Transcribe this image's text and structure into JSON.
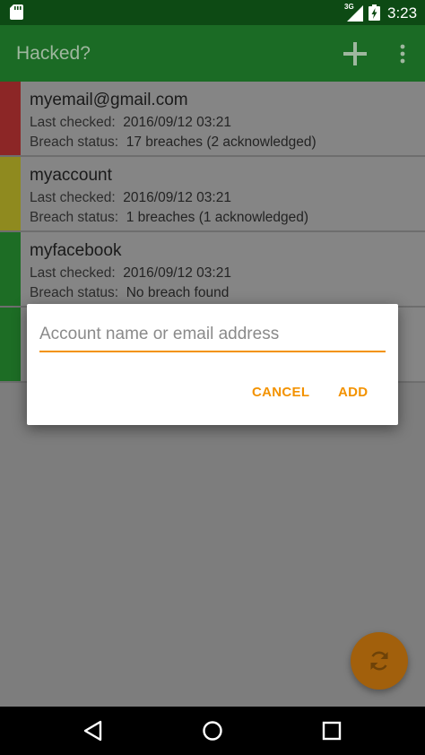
{
  "status_bar": {
    "network_type": "3G",
    "time": "3:23",
    "icons": [
      "sd-card-icon",
      "signal-icon",
      "battery-icon"
    ]
  },
  "app_bar": {
    "title": "Hacked?",
    "add_icon": "plus-icon",
    "menu_icon": "more-vert-icon"
  },
  "accounts": [
    {
      "name": "myemail@gmail.com",
      "last_checked_label": "Last checked:",
      "last_checked": "2016/09/12 03:21",
      "breach_status_label": "Breach status:",
      "breach_status": "17 breaches (2 acknowledged)",
      "indicator_color": "#8c2626"
    },
    {
      "name": "myaccount",
      "last_checked_label": "Last checked:",
      "last_checked": "2016/09/12 03:21",
      "breach_status_label": "Breach status:",
      "breach_status": "1 breaches (1 acknowledged)",
      "indicator_color": "#8f8a1f"
    },
    {
      "name": "myfacebook",
      "last_checked_label": "Last checked:",
      "last_checked": "2016/09/12 03:21",
      "breach_status_label": "Breach status:",
      "breach_status": "No breach found",
      "indicator_color": "#1d6d25"
    },
    {
      "name": "",
      "last_checked_label": "",
      "last_checked": "",
      "breach_status_label": "",
      "breach_status": "",
      "indicator_color": "#1d6d25"
    }
  ],
  "dialog": {
    "input_placeholder": "Account name or email address",
    "input_value": "",
    "cancel_label": "CANCEL",
    "add_label": "ADD",
    "accent_color": "#f39200"
  },
  "fab": {
    "icon": "refresh-icon",
    "color": "#a2600c"
  },
  "nav_bar": {
    "back_icon": "back-icon",
    "home_icon": "home-icon",
    "recents_icon": "recents-icon"
  }
}
